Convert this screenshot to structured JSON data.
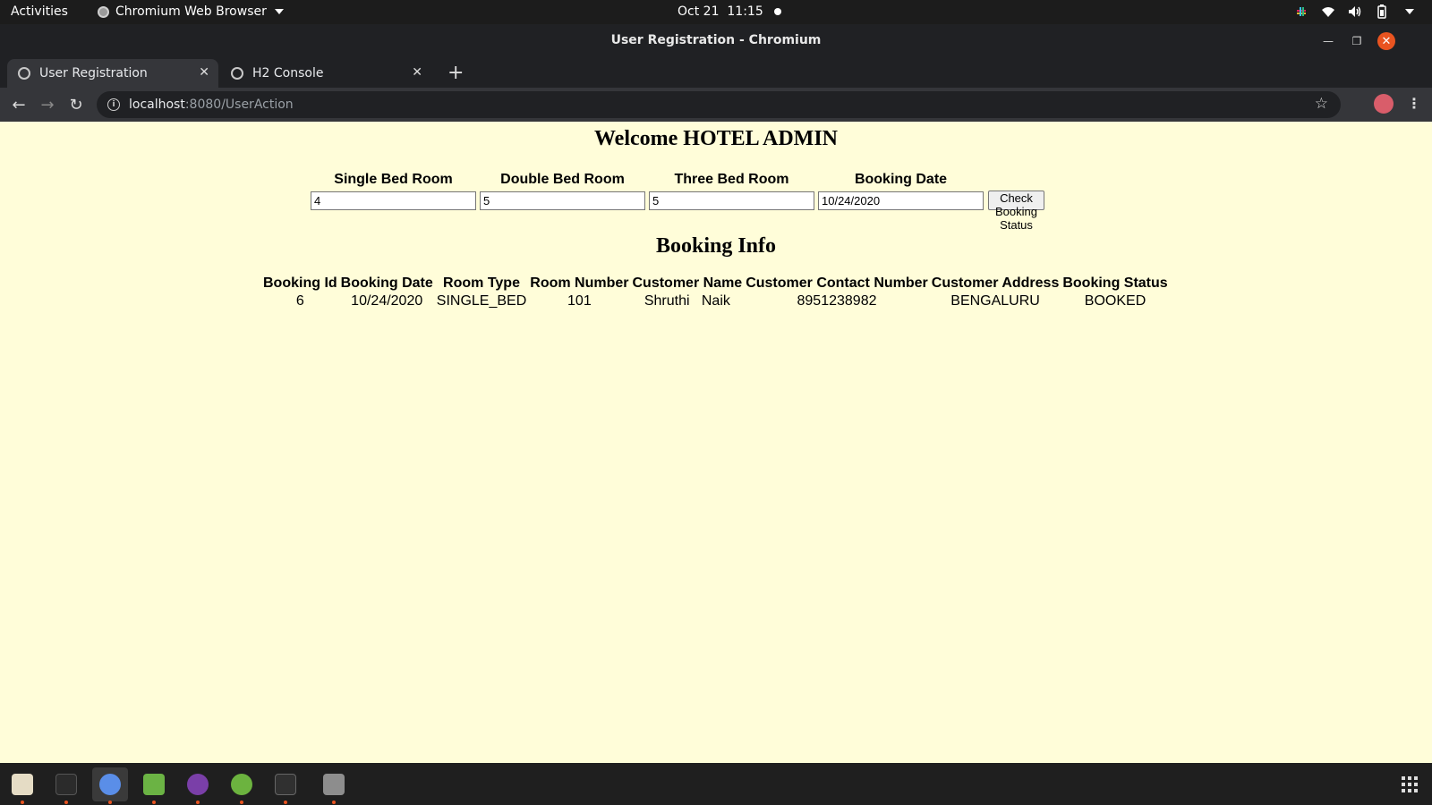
{
  "system": {
    "activities": "Activities",
    "app_name": "Chromium Web Browser",
    "date": "Oct 21",
    "time": "11:15"
  },
  "window": {
    "title": "User Registration - Chromium"
  },
  "tabs": [
    {
      "label": "User Registration",
      "active": true
    },
    {
      "label": "H2 Console",
      "active": false
    }
  ],
  "address": {
    "host": "localhost",
    "path": ":8080/UserAction"
  },
  "page": {
    "heading": "Welcome HOTEL ADMIN",
    "form": {
      "single_label": "Single Bed Room",
      "single_value": "4",
      "double_label": "Double Bed Room",
      "double_value": "5",
      "three_label": "Three Bed Room",
      "three_value": "5",
      "date_label": "Booking Date",
      "date_value": "10/24/2020",
      "submit_label": "Check Booking Status"
    },
    "subheading": "Booking Info",
    "table": {
      "headers": [
        "Booking Id",
        "Booking Date",
        "Room Type",
        "Room Number",
        "Customer Name",
        "Customer Contact Number",
        "Customer Address",
        "Booking Status"
      ],
      "rows": [
        [
          "6",
          "10/24/2020",
          "SINGLE_BED",
          "101",
          "Shruthi   Naik",
          "8951238982",
          "BENGALURU",
          "BOOKED"
        ]
      ]
    }
  },
  "dock": [
    {
      "name": "files",
      "color": "#e5dcc5",
      "running": true
    },
    {
      "name": "system-monitor",
      "color": "#2b2b2b",
      "running": true
    },
    {
      "name": "chromium",
      "color": "#5a8ee8",
      "running": true
    },
    {
      "name": "image-editor",
      "color": "#6bb344",
      "running": true
    },
    {
      "name": "github-desktop",
      "color": "#7a3fa8",
      "running": true
    },
    {
      "name": "spring-tool-suite",
      "color": "#6cb33f",
      "running": true
    },
    {
      "name": "terminal",
      "color": "#303030",
      "running": true
    },
    {
      "name": "settings",
      "color": "#8d8d8d",
      "running": true
    }
  ],
  "colors": {
    "page_background": "#fffdd9",
    "close_button": "#e95420"
  }
}
